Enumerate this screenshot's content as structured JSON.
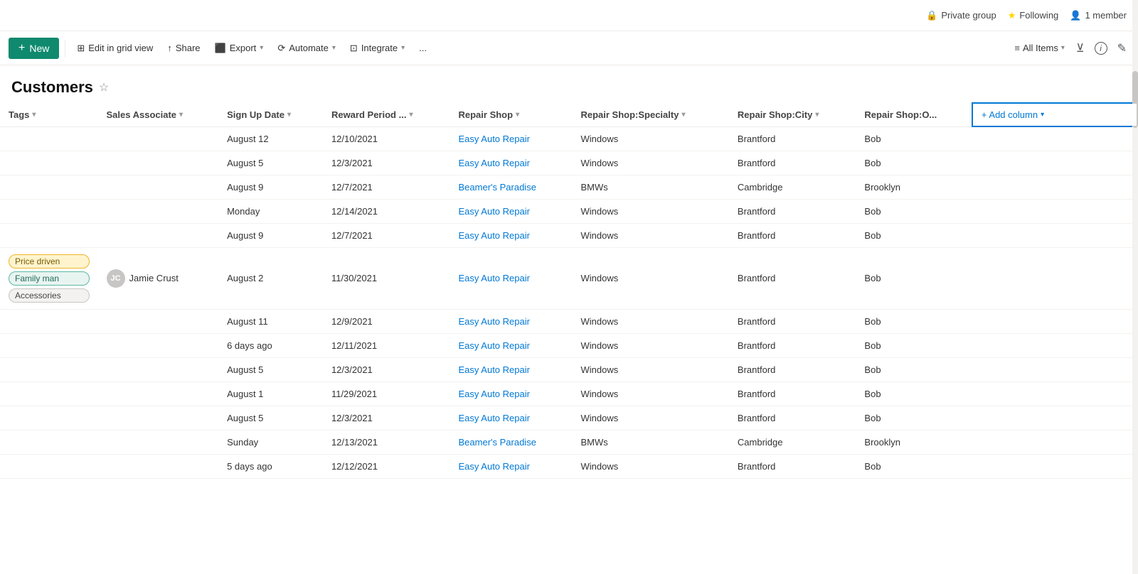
{
  "topbar": {
    "private_group_label": "Private group",
    "following_label": "Following",
    "member_label": "1 member"
  },
  "toolbar": {
    "new_label": "New",
    "edit_grid_label": "Edit in grid view",
    "share_label": "Share",
    "export_label": "Export",
    "automate_label": "Automate",
    "integrate_label": "Integrate",
    "more_label": "...",
    "all_items_label": "All Items"
  },
  "page": {
    "title": "Customers"
  },
  "columns": [
    {
      "id": "tags",
      "label": "Tags",
      "has_chevron": true
    },
    {
      "id": "sales_associate",
      "label": "Sales Associate",
      "has_chevron": true
    },
    {
      "id": "sign_up_date",
      "label": "Sign Up Date",
      "has_chevron": true
    },
    {
      "id": "reward_period",
      "label": "Reward Period ...",
      "has_chevron": true
    },
    {
      "id": "repair_shop",
      "label": "Repair Shop",
      "has_chevron": true
    },
    {
      "id": "repair_shop_specialty",
      "label": "Repair Shop:Specialty",
      "has_chevron": true
    },
    {
      "id": "repair_shop_city",
      "label": "Repair Shop:City",
      "has_chevron": true
    },
    {
      "id": "repair_shop_o",
      "label": "Repair Shop:O...",
      "has_chevron": false
    },
    {
      "id": "add_column",
      "label": "+ Add column",
      "has_chevron": true
    }
  ],
  "rows": [
    {
      "tags": [],
      "sales_associate": null,
      "sign_up_date": "August 12",
      "reward_period": "12/10/2021",
      "repair_shop": "Easy Auto Repair",
      "repair_shop_specialty": "Windows",
      "repair_shop_city": "Brantford",
      "repair_shop_o": "Bob"
    },
    {
      "tags": [],
      "sales_associate": null,
      "sign_up_date": "August 5",
      "reward_period": "12/3/2021",
      "repair_shop": "Easy Auto Repair",
      "repair_shop_specialty": "Windows",
      "repair_shop_city": "Brantford",
      "repair_shop_o": "Bob"
    },
    {
      "tags": [],
      "sales_associate": null,
      "sign_up_date": "August 9",
      "reward_period": "12/7/2021",
      "repair_shop": "Beamer's Paradise",
      "repair_shop_specialty": "BMWs",
      "repair_shop_city": "Cambridge",
      "repair_shop_o": "Brooklyn"
    },
    {
      "tags": [],
      "sales_associate": null,
      "sign_up_date": "Monday",
      "reward_period": "12/14/2021",
      "repair_shop": "Easy Auto Repair",
      "repair_shop_specialty": "Windows",
      "repair_shop_city": "Brantford",
      "repair_shop_o": "Bob"
    },
    {
      "tags": [],
      "sales_associate": null,
      "sign_up_date": "August 9",
      "reward_period": "12/7/2021",
      "repair_shop": "Easy Auto Repair",
      "repair_shop_specialty": "Windows",
      "repair_shop_city": "Brantford",
      "repair_shop_o": "Bob"
    },
    {
      "tags": [
        "Price driven",
        "Family man",
        "Accessories"
      ],
      "sales_associate": "Jamie Crust",
      "sign_up_date": "August 2",
      "reward_period": "11/30/2021",
      "repair_shop": "Easy Auto Repair",
      "repair_shop_specialty": "Windows",
      "repair_shop_city": "Brantford",
      "repair_shop_o": "Bob"
    },
    {
      "tags": [],
      "sales_associate": null,
      "sign_up_date": "August 11",
      "reward_period": "12/9/2021",
      "repair_shop": "Easy Auto Repair",
      "repair_shop_specialty": "Windows",
      "repair_shop_city": "Brantford",
      "repair_shop_o": "Bob"
    },
    {
      "tags": [],
      "sales_associate": null,
      "sign_up_date": "6 days ago",
      "reward_period": "12/11/2021",
      "repair_shop": "Easy Auto Repair",
      "repair_shop_specialty": "Windows",
      "repair_shop_city": "Brantford",
      "repair_shop_o": "Bob"
    },
    {
      "tags": [],
      "sales_associate": null,
      "sign_up_date": "August 5",
      "reward_period": "12/3/2021",
      "repair_shop": "Easy Auto Repair",
      "repair_shop_specialty": "Windows",
      "repair_shop_city": "Brantford",
      "repair_shop_o": "Bob"
    },
    {
      "tags": [],
      "sales_associate": null,
      "sign_up_date": "August 1",
      "reward_period": "11/29/2021",
      "repair_shop": "Easy Auto Repair",
      "repair_shop_specialty": "Windows",
      "repair_shop_city": "Brantford",
      "repair_shop_o": "Bob"
    },
    {
      "tags": [],
      "sales_associate": null,
      "sign_up_date": "August 5",
      "reward_period": "12/3/2021",
      "repair_shop": "Easy Auto Repair",
      "repair_shop_specialty": "Windows",
      "repair_shop_city": "Brantford",
      "repair_shop_o": "Bob"
    },
    {
      "tags": [],
      "sales_associate": null,
      "sign_up_date": "Sunday",
      "reward_period": "12/13/2021",
      "repair_shop": "Beamer's Paradise",
      "repair_shop_specialty": "BMWs",
      "repair_shop_city": "Cambridge",
      "repair_shop_o": "Brooklyn"
    },
    {
      "tags": [],
      "sales_associate": null,
      "sign_up_date": "5 days ago",
      "reward_period": "12/12/2021",
      "repair_shop": "Easy Auto Repair",
      "repair_shop_specialty": "Windows",
      "repair_shop_city": "Brantford",
      "repair_shop_o": "Bob"
    }
  ],
  "tag_styles": {
    "Price driven": "tag-orange",
    "Family man": "tag-teal",
    "Accessories": "tag-gray"
  },
  "add_column_label": "+ Add column",
  "cursor_label": "cursor-default"
}
